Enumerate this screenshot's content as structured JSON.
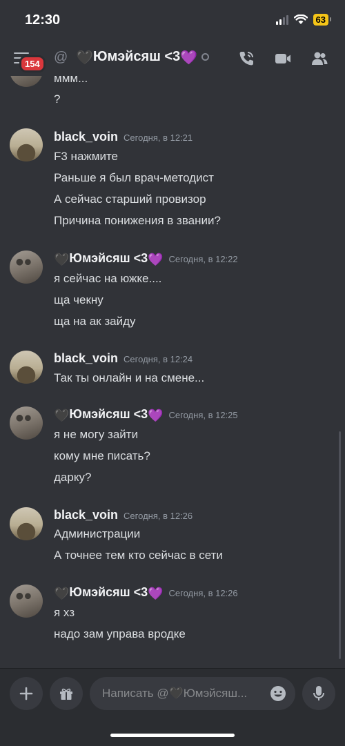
{
  "status_bar": {
    "time": "12:30",
    "battery": "63"
  },
  "header": {
    "badge": "154",
    "at_symbol": "@",
    "title_prefix": "🖤",
    "title_name": "Юмэйсяш <3",
    "title_suffix": "💜",
    "icons": [
      "hamburger-icon",
      "phone-call-icon",
      "video-camera-icon",
      "members-icon"
    ]
  },
  "messages": {
    "partial": {
      "lines": [
        "ммм...",
        "?"
      ]
    },
    "m1": {
      "author": "black_voin",
      "timestamp": "Сегодня, в 12:21",
      "lines": [
        "F3 нажмите",
        "Раньше я был врач-методист",
        "А сейчас старший провизор",
        "Причина понижения в звании?"
      ]
    },
    "m2": {
      "author_prefix": "🖤",
      "author": "Юмэйсяш <3",
      "author_suffix": "💜",
      "timestamp": "Сегодня, в 12:22",
      "lines": [
        "я сейчас на южке....",
        "ща чекну",
        "ща на ак зайду"
      ]
    },
    "m3": {
      "author": "black_voin",
      "timestamp": "Сегодня, в 12:24",
      "lines": [
        "Так ты онлайн и на смене..."
      ]
    },
    "m4": {
      "author_prefix": "🖤",
      "author": "Юмэйсяш <3",
      "author_suffix": "💜",
      "timestamp": "Сегодня, в 12:25",
      "lines": [
        "я не могу зайти",
        "кому мне писать?",
        "дарку?"
      ]
    },
    "m5": {
      "author": "black_voin",
      "timestamp": "Сегодня, в 12:26",
      "lines": [
        "Администрации",
        "А точнее тем кто сейчас в сети"
      ]
    },
    "m6": {
      "author_prefix": "🖤",
      "author": "Юмэйсяш <3",
      "author_suffix": "💜",
      "timestamp": "Сегодня, в 12:26",
      "lines": [
        "я хз",
        "надо зам управа вродке"
      ]
    }
  },
  "composer": {
    "placeholder": "Написать @🖤Юмэйсяш...",
    "icons": [
      "plus-icon",
      "gift-icon",
      "emoji-icon",
      "microphone-icon"
    ]
  },
  "colors": {
    "background": "#313338",
    "composer": "#2b2d31",
    "badge": "#da373c",
    "battery": "#f5c518"
  }
}
